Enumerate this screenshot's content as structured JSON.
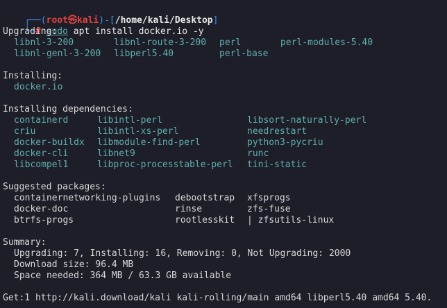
{
  "prompt": {
    "user": "root",
    "skull": "㉿",
    "host": "kali",
    "path": "/home/kali/Desktop",
    "symbol": "#",
    "cmd_sudo": "sudo",
    "cmd_rest": " apt install docker.io -y"
  },
  "upgrading": {
    "heading": "Upgrading:",
    "rows": [
      [
        "libnl-3-200",
        "libnl-route-3-200",
        "perl",
        "perl-modules-5.40"
      ],
      [
        "libnl-genl-3-200",
        "libperl5.40",
        "perl-base",
        ""
      ]
    ]
  },
  "installing": {
    "heading": "Installing:",
    "items": [
      "docker.io"
    ]
  },
  "dependencies": {
    "heading": "Installing dependencies:",
    "rows": [
      [
        "containerd",
        "libintl-perl",
        "libsort-naturally-perl"
      ],
      [
        "criu",
        "libintl-xs-perl",
        "needrestart"
      ],
      [
        "docker-buildx",
        "libmodule-find-perl",
        "python3-pycriu"
      ],
      [
        "docker-cli",
        "libnet9",
        "runc"
      ],
      [
        "libcompel1",
        "libproc-processtable-perl",
        "tini-static"
      ]
    ]
  },
  "suggested": {
    "heading": "Suggested packages:",
    "rows": [
      [
        "containernetworking-plugins",
        "debootstrap",
        "xfsprogs"
      ],
      [
        "docker-doc",
        "rinse",
        "zfs-fuse"
      ],
      [
        "btrfs-progs",
        "rootlesskit",
        "| zfsutils-linux"
      ]
    ]
  },
  "summary": {
    "heading": "Summary:",
    "lines": [
      "Upgrading: 7, Installing: 16, Removing: 0, Not Upgrading: 2000",
      "Download size: 96.4 MB",
      "Space needed: 364 MB / 63.3 GB available"
    ]
  },
  "get_line": "Get:1 http://kali.download/kali kali-rolling/main amd64 libperl5.40 amd64 5.40.",
  "colors": {
    "background": "#1e1e28",
    "text": "#d8d8d8",
    "package": "#5fafaf",
    "prompt_frame": "#3b8eea",
    "prompt_user": "#e0433f"
  }
}
